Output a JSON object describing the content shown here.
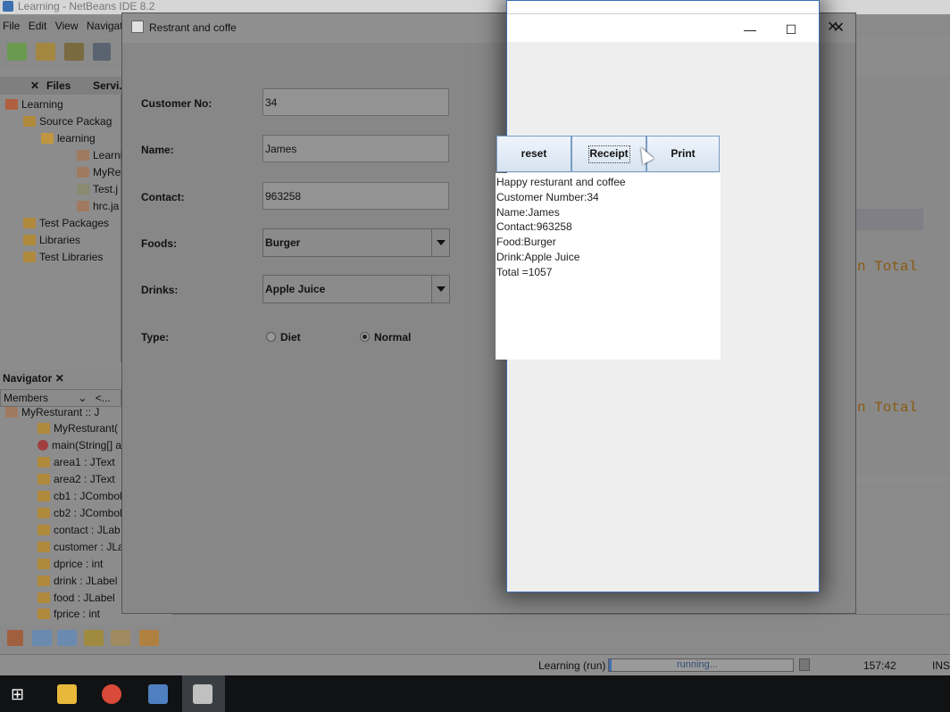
{
  "ide": {
    "title": "Learning - NetBeans IDE 8.2",
    "menu": [
      "File",
      "Edit",
      "View",
      "Navigat"
    ],
    "tabs": [
      "Files",
      "Servi."
    ],
    "tree": [
      "Learning",
      "Source Packag",
      "learning",
      "Learni",
      "MyRes",
      "Test.j",
      "hrc.ja",
      "Test Packages",
      "Libraries",
      "Test Libraries"
    ],
    "navigator_title": "Navigator",
    "members_label": "Members",
    "members_filter": "<...",
    "navigator_items": [
      "MyResturant :: J",
      "MyResturant(",
      "main(String[] a",
      "area1 : JText",
      "area2 : JText",
      "cb1 : JCombol",
      "cb2 : JCombol",
      "contact : JLab",
      "customer : JLa",
      "dprice : int",
      "drink : JLabel",
      "food : JLabel",
      "fprice : int"
    ],
    "code_snippets": [
      "n Total",
      "n Total"
    ],
    "status": {
      "run_label": "Learning (run)",
      "progress_text": "running...",
      "position": "157:42",
      "mode": "INS"
    }
  },
  "restaurant": {
    "title": "Restrant and coffe",
    "labels": {
      "customer_no": "Customer No:",
      "name": "Name:",
      "contact": "Contact:",
      "foods": "Foods:",
      "drinks": "Drinks:",
      "type": "Type:"
    },
    "values": {
      "customer_no": "34",
      "name": "James",
      "contact": "963258",
      "food": "Burger",
      "drink": "Apple Juice"
    },
    "radio": {
      "diet": "Diet",
      "normal": "Normal",
      "selected": "Normal"
    }
  },
  "receipt": {
    "buttons": {
      "reset": "reset",
      "receipt": "Receipt",
      "print": "Print"
    },
    "window_controls": {
      "minimize": "—",
      "maximize": "☐",
      "close": "✕"
    },
    "lines": [
      "Happy resturant and coffee",
      " Customer Number:34",
      " Name:James",
      " Contact:963258",
      "Food:Burger",
      "Drink:Apple Juice",
      " Total =1057"
    ]
  }
}
